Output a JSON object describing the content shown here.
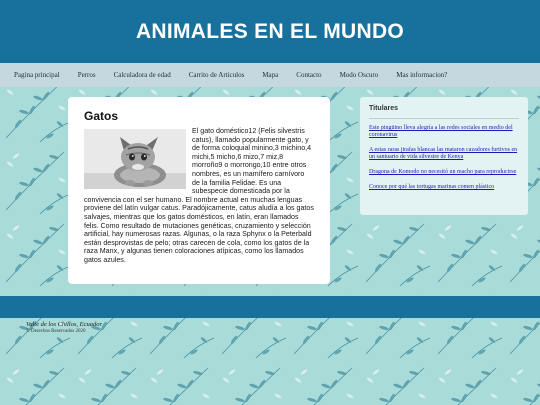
{
  "header": {
    "title": "ANIMALES EN EL MUNDO"
  },
  "nav": {
    "items": [
      {
        "label": "Pagina principal"
      },
      {
        "label": "Perros"
      },
      {
        "label": "Calculadora de edad"
      },
      {
        "label": "Carrito de Articulos"
      },
      {
        "label": "Mapa"
      },
      {
        "label": "Contacto"
      },
      {
        "label": "Modo Oscuro"
      },
      {
        "label": "Mas informacion?"
      }
    ]
  },
  "article": {
    "title": "Gatos",
    "body": "El gato doméstico12 (Felis silvestris catus), llamado popularmente gato, y de forma coloquial minino,3 michino,4 michi,5 micho,6 mizo,7 miz,8 morroño9 o morrongo,10 entre otros nombres, es un mamífero carnívoro de la familia Felidae. Es una subespecie domesticada por la convivencia con el ser humano. El nombre actual en muchas lenguas proviene del latín vulgar catus. Paradójicamente, catus aludía a los gatos salvajes, mientras que los gatos domésticos, en latín, eran llamados felis. Como resultado de mutaciones genéticas, cruzamiento y selección artificial, hay numerosas razas. Algunas, o la raza Sphynx o la Peterbald están desprovistas de pelo; otras carecen de cola, como los gatos de la raza Manx, y algunas tienen coloraciones atípicas, como los llamados gatos azules."
  },
  "sidebar": {
    "title": "Titulares",
    "links": [
      {
        "label": "Este pingüino lleva alegría a las redes sociales en medio del coronavirus"
      },
      {
        "label": "A estas raras jirafas blancas las mataron cazadores furtivos en un santuario de vida silvestre de Kenya"
      },
      {
        "label": "Dragona de Komodo no necesitó un macho para reproducirse"
      },
      {
        "label": "Conoce por qué las tortugas marinas comen plástico"
      }
    ]
  },
  "footer": {
    "place": "Valle de los Chillos, Ecuador",
    "rights": "© Derechos Reservados 2020"
  },
  "colors": {
    "header_bg": "#17719c",
    "nav_bg": "#c5d8e0",
    "page_bg": "#a9dcd8",
    "link": "#1a1ab8"
  }
}
